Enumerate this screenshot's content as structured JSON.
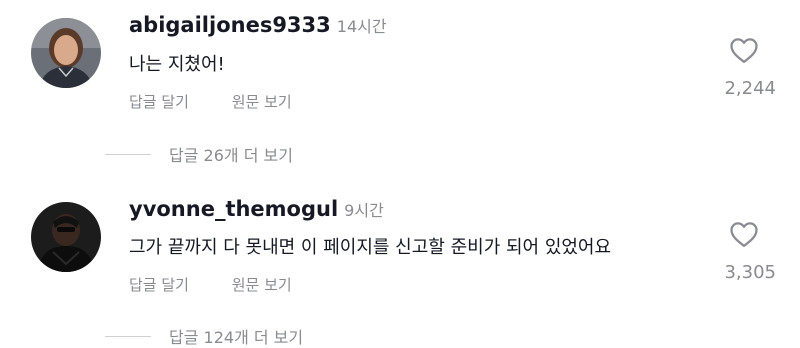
{
  "comments": [
    {
      "username": "abigailjones9333",
      "time": "14시간",
      "text": "나는 지쳤어!",
      "reply_label": "답글 달기",
      "original_label": "원문 보기",
      "likes": "2,244",
      "view_replies": "답글 26개 더 보기",
      "avatar_icon": "profile-photo"
    },
    {
      "username": "yvonne_themogul",
      "time": "9시간",
      "text": "그가 끝까지 다 못내면 이 페이지를 신고할 준비가 되어 있었어요",
      "reply_label": "답글 달기",
      "original_label": "원문 보기",
      "likes": "3,305",
      "view_replies": "답글 124개 더 보기",
      "avatar_icon": "profile-photo"
    }
  ],
  "colors": {
    "text": "#161823",
    "muted": "#8a8b91",
    "divider": "#d0d1d3"
  },
  "icons": {
    "like": "heart-outline-icon"
  }
}
